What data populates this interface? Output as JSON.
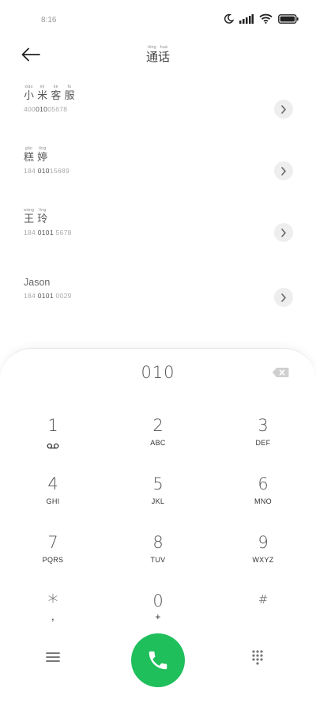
{
  "status_bar": {
    "time": "8:16"
  },
  "header": {
    "title_chars": [
      {
        "py": "tōng",
        "ch": "通"
      },
      {
        "py": "huà",
        "ch": "话"
      }
    ]
  },
  "contacts": [
    {
      "name_chars": [
        {
          "py": "xiǎo",
          "ch": "小"
        },
        {
          "py": "mǐ",
          "ch": "米"
        },
        {
          "py": "kè",
          "ch": "客"
        },
        {
          "py": "fú",
          "ch": "服"
        }
      ],
      "number_pre": "400",
      "number_match": "010",
      "number_post": "05678"
    },
    {
      "name_chars": [
        {
          "py": "gāo",
          "ch": "糕"
        },
        {
          "py": "tíng",
          "ch": "婷"
        }
      ],
      "number_pre": "184 ",
      "number_match": "010",
      "number_post": "15689"
    },
    {
      "name_chars": [
        {
          "py": "wáng",
          "ch": "王"
        },
        {
          "py": "líng",
          "ch": "玲"
        }
      ],
      "number_pre": "184 ",
      "number_match": "0101",
      "number_post": " 5678"
    },
    {
      "name": "Jason",
      "number_pre": "184 ",
      "number_match": "0101",
      "number_post": " 0029"
    }
  ],
  "dialpad": {
    "dialed": "010",
    "keys": [
      {
        "digit": "1",
        "letters": "",
        "icon": "voicemail-icon"
      },
      {
        "digit": "2",
        "letters": "ABC"
      },
      {
        "digit": "3",
        "letters": "DEF"
      },
      {
        "digit": "4",
        "letters": "GHI"
      },
      {
        "digit": "5",
        "letters": "JKL"
      },
      {
        "digit": "6",
        "letters": "MNO"
      },
      {
        "digit": "7",
        "letters": "PQRS"
      },
      {
        "digit": "8",
        "letters": "TUV"
      },
      {
        "digit": "9",
        "letters": "WXYZ"
      },
      {
        "digit": "*",
        "letters": ","
      },
      {
        "digit": "0",
        "letters": "+"
      },
      {
        "digit": "#",
        "letters": ""
      }
    ]
  },
  "icons": {
    "back": "back-arrow-icon",
    "delete": "backspace-icon",
    "menu": "menu-icon",
    "call": "phone-icon",
    "dialpad_toggle": "dialpad-grid-icon"
  },
  "colors": {
    "call_green": "#1fbf5c",
    "accent_gray": "#9a9a9a"
  }
}
